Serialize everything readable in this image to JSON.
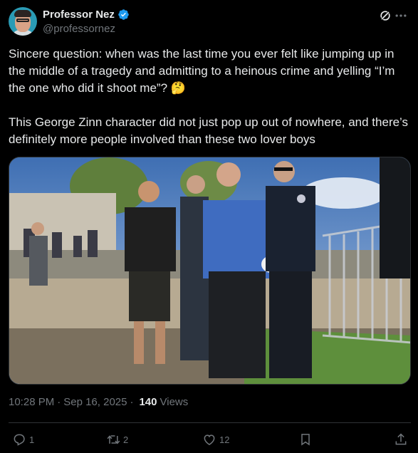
{
  "author": {
    "display_name": "Professor Nez",
    "handle": "@professornez",
    "verified": true,
    "verified_color": "#1d9bf0"
  },
  "tweet": {
    "text": "Sincere question: when was the last time you ever felt like jumping up in the middle of a tragedy and admitting to a heinous crime and yelling “I’m the one who did it shoot me”? 🤔\n\nThis George Zinn character did not just pop up out of nowhere, and there’s definitely more people involved than these two lover boys"
  },
  "meta": {
    "time": "10:28 PM",
    "date": "Sep 16, 2025",
    "separator": "·",
    "views_count": "140",
    "views_label": "Views"
  },
  "actions": {
    "reply_count": "1",
    "repost_count": "2",
    "like_count": "12"
  },
  "icons": [
    "grok-icon",
    "more-icon",
    "reply-icon",
    "repost-icon",
    "like-icon",
    "bookmark-icon",
    "share-icon",
    "verified-icon"
  ],
  "colors": {
    "background": "#000000",
    "text": "#e7e9ea",
    "muted": "#71767b",
    "border": "#2f3336"
  }
}
